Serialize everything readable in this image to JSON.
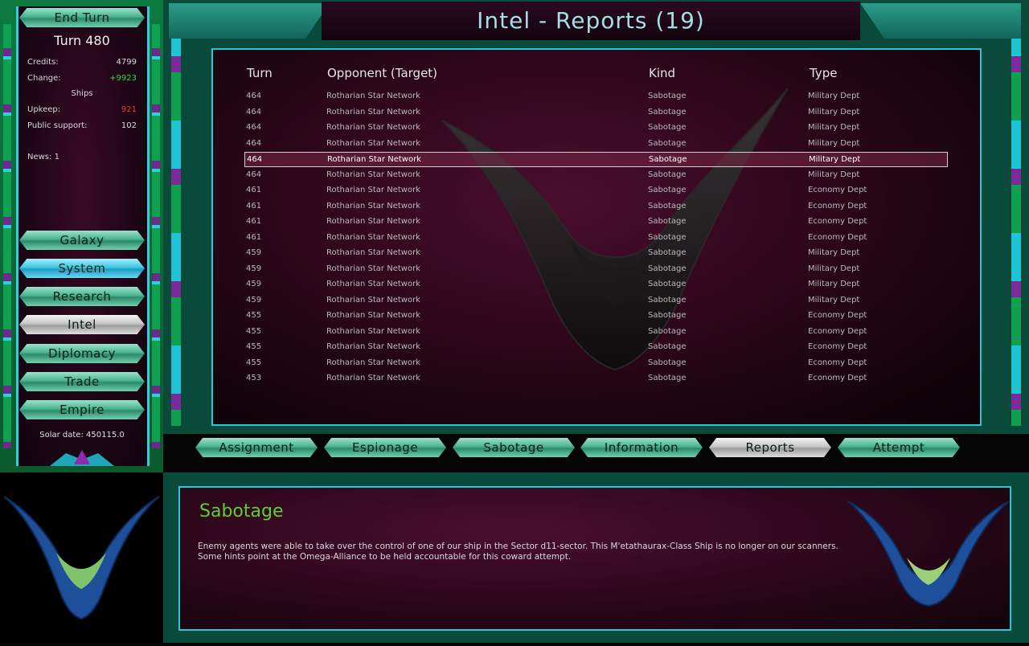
{
  "sidebar": {
    "end_turn": "End Turn",
    "turn": "Turn 480",
    "stats": {
      "credits_label": "Credits:",
      "credits_value": "4799",
      "change_label": "Change:",
      "change_value": "+9923",
      "ships_heading": "Ships",
      "upkeep_label": "Upkeep:",
      "upkeep_value": "921",
      "support_label": "Public support:",
      "support_value": "102",
      "news": "News: 1"
    },
    "nav": [
      "Galaxy",
      "System",
      "Research",
      "Intel",
      "Diplomacy",
      "Trade",
      "Empire"
    ],
    "solar_date": "Solar date: 450115.0"
  },
  "title": "Intel - Reports (19)",
  "table": {
    "headers": [
      "Turn",
      "Opponent (Target)",
      "Kind",
      "Type"
    ],
    "rows": [
      [
        "464",
        "Rotharian Star Network",
        "Sabotage",
        "Military Dept"
      ],
      [
        "464",
        "Rotharian Star Network",
        "Sabotage",
        "Military Dept"
      ],
      [
        "464",
        "Rotharian Star Network",
        "Sabotage",
        "Military Dept"
      ],
      [
        "464",
        "Rotharian Star Network",
        "Sabotage",
        "Military Dept"
      ],
      [
        "464",
        "Rotharian Star Network",
        "Sabotage",
        "Military Dept"
      ],
      [
        "464",
        "Rotharian Star Network",
        "Sabotage",
        "Military Dept"
      ],
      [
        "461",
        "Rotharian Star Network",
        "Sabotage",
        "Economy Dept"
      ],
      [
        "461",
        "Rotharian Star Network",
        "Sabotage",
        "Economy Dept"
      ],
      [
        "461",
        "Rotharian Star Network",
        "Sabotage",
        "Economy Dept"
      ],
      [
        "461",
        "Rotharian Star Network",
        "Sabotage",
        "Economy Dept"
      ],
      [
        "459",
        "Rotharian Star Network",
        "Sabotage",
        "Military Dept"
      ],
      [
        "459",
        "Rotharian Star Network",
        "Sabotage",
        "Military Dept"
      ],
      [
        "459",
        "Rotharian Star Network",
        "Sabotage",
        "Military Dept"
      ],
      [
        "459",
        "Rotharian Star Network",
        "Sabotage",
        "Military Dept"
      ],
      [
        "455",
        "Rotharian Star Network",
        "Sabotage",
        "Economy Dept"
      ],
      [
        "455",
        "Rotharian Star Network",
        "Sabotage",
        "Economy Dept"
      ],
      [
        "455",
        "Rotharian Star Network",
        "Sabotage",
        "Economy Dept"
      ],
      [
        "455",
        "Rotharian Star Network",
        "Sabotage",
        "Economy Dept"
      ],
      [
        "453",
        "Rotharian Star Network",
        "Sabotage",
        "Economy Dept"
      ]
    ],
    "selected_index": 4
  },
  "tabs": [
    "Assignment",
    "Espionage",
    "Sabotage",
    "Information",
    "Reports",
    "Attempt"
  ],
  "message": {
    "title": "Sabotage",
    "text": "Enemy agents were able to take over the control of one of our ship in the Sector d11-sector. This M'etathaurax-Class Ship is no longer on our scanners. Some hints point at the Omega-Alliance to be held accountable for this coward attempt."
  },
  "colors": {
    "accent": "#2fd0e0",
    "frame": "#0c7a3f",
    "message_title": "#5ed02a"
  }
}
